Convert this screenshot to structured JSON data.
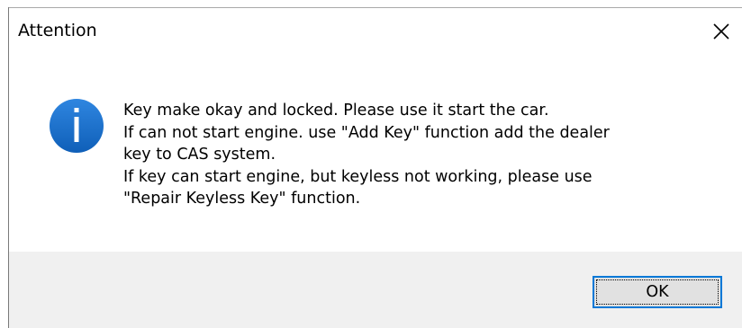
{
  "dialog": {
    "title": "Attention",
    "close_icon": "close-icon",
    "icon": "info-icon",
    "message_lines": [
      "Key make okay and locked. Please use it start the car.",
      "If can not start engine. use \"Add Key\" function add the dealer",
      "key to CAS system.",
      "If key can start engine, but keyless not working, please use",
      "\"Repair Keyless Key\" function."
    ],
    "ok_label": "OK"
  },
  "colors": {
    "info_icon_blue": "#1a6dc8",
    "focus_border": "#0078d7",
    "footer_bg": "#f0f0f0",
    "button_bg": "#e1e1e1"
  }
}
